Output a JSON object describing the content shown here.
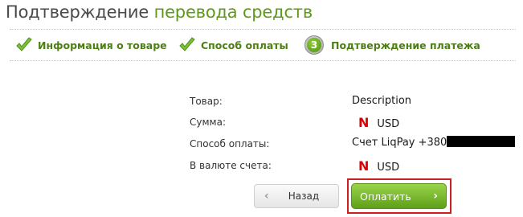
{
  "page": {
    "title_prefix": "Подтверждение",
    "title_accent": "перевода средств"
  },
  "steps": [
    {
      "label": "Информация о товаре",
      "state": "done",
      "icon": "check-icon"
    },
    {
      "label": "Способ оплаты",
      "state": "done",
      "icon": "check-icon"
    },
    {
      "number": "3",
      "label": "Подтверждение платежа",
      "state": "current"
    }
  ],
  "details": {
    "product_label": "Товар:",
    "product_value": "Description",
    "amount_label": "Сумма:",
    "amount_currency": "USD",
    "amount_redacted_marker": "N",
    "method_label": "Способ оплаты:",
    "method_value": "Счет LiqPay +380",
    "account_currency_label": "В валюте счета:",
    "account_currency": "USD",
    "account_redacted_marker": "N"
  },
  "buttons": {
    "back_label": "Назад",
    "pay_label": "Оплатить"
  },
  "colors": {
    "accent_green": "#5c9a1a",
    "highlight_red": "#cc1f1f"
  }
}
